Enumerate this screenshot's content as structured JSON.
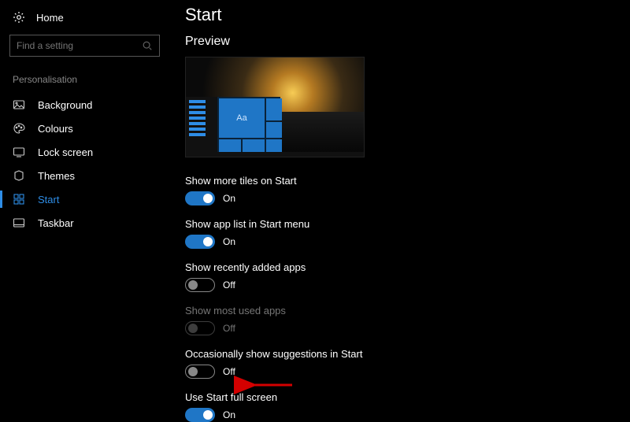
{
  "sidebar": {
    "home": "Home",
    "search_placeholder": "Find a setting",
    "section": "Personalisation",
    "items": [
      {
        "label": "Background"
      },
      {
        "label": "Colours"
      },
      {
        "label": "Lock screen"
      },
      {
        "label": "Themes"
      },
      {
        "label": "Start"
      },
      {
        "label": "Taskbar"
      }
    ]
  },
  "main": {
    "title": "Start",
    "preview_label": "Preview",
    "preview_tile_text": "Aa",
    "settings": [
      {
        "label": "Show more tiles on Start",
        "on": true,
        "state": "On"
      },
      {
        "label": "Show app list in Start menu",
        "on": true,
        "state": "On"
      },
      {
        "label": "Show recently added apps",
        "on": false,
        "state": "Off"
      },
      {
        "label": "Show most used apps",
        "on": false,
        "state": "Off",
        "disabled": true
      },
      {
        "label": "Occasionally show suggestions in Start",
        "on": false,
        "state": "Off"
      },
      {
        "label": "Use Start full screen",
        "on": true,
        "state": "On"
      }
    ]
  },
  "colors": {
    "accent": "#1f76c6",
    "annotation": "#d40000"
  }
}
